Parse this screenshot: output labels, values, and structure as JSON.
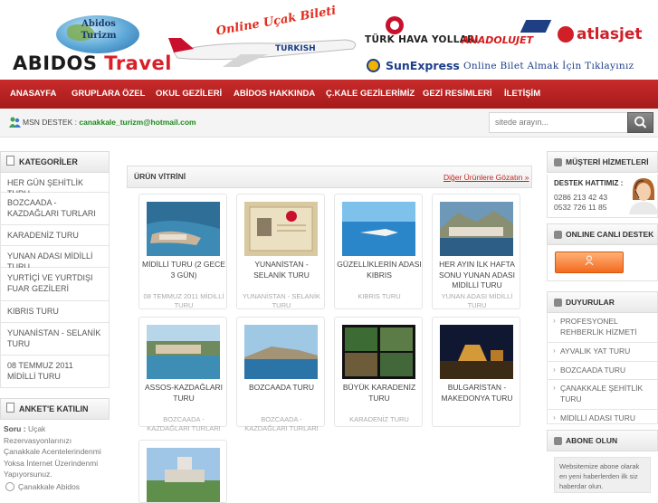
{
  "header": {
    "logo_badge_line1": "Abidos",
    "logo_badge_line2": "Turizm",
    "brand_main": "ABIDOS",
    "brand_accent": "Travel",
    "online_ticket_tag": "Online Uçak Bileti",
    "airlines": {
      "thy": "TÜRK HAVA YOLLARI",
      "anadolujet": "ANADOLUJET",
      "atlasjet": "atlasjet",
      "sunexpress": "SunExpress"
    },
    "online_bilet_text": "Online Bilet Almak İçin Tıklayınız"
  },
  "nav": {
    "items": [
      "ANASAYFA",
      "GRUPLARA ÖZEL",
      "OKUL GEZİLERİ",
      "ABİDOS HAKKINDA",
      "Ç.KALE GEZİLERİMİZ",
      "GEZİ RESİMLERİ",
      "İLETİŞİM"
    ]
  },
  "strip": {
    "msn_label": "MSN DESTEK :",
    "msn_email": "canakkale_turizm@hotmail.com",
    "search_placeholder": "sitede arayın..."
  },
  "left": {
    "categories_title": "KATEGORİLER",
    "categories": [
      "HER GÜN ŞEHİTLİK TURU",
      "BOZCAADA - KAZDAĞLARI TURLARI",
      "KARADENİZ TURU",
      "YUNAN ADASI MİDİLLİ TURU",
      "YURTİÇİ VE YURTDIŞI FUAR GEZİLERİ",
      "KIBRIS TURU",
      "YUNANİSTAN - SELANİK TURU",
      "08 TEMMUZ 2011 MİDİLLİ TURU"
    ],
    "anket_title": "ANKET'E KATILIN",
    "anket_q_label": "Soru :",
    "anket_question": "Uçak Rezervasyonlarınızı Çanakkale Acentelerindenmi Yoksa İnternet Üzerindenmi Yapıyorsunuz.",
    "anket_option1": "Çanakkale Abidos"
  },
  "center": {
    "title": "ÜRÜN VİTRİNİ",
    "more_link": "Diğer Ürünlere Gözatın »",
    "products": [
      {
        "title": "MİDİLLİ TURU (2 GECE 3 GÜN)",
        "category": "08 TEMMUZ 2011 MİDİLLİ TURU"
      },
      {
        "title": "YUNANİSTAN - SELANİK TURU",
        "category": "YUNANİSTAN - SELANİK TURU"
      },
      {
        "title": "GÜZELLİKLERİN ADASI KIBRIS",
        "category": "KIBRIS TURU"
      },
      {
        "title": "HER AYIN İLK HAFTA SONU YUNAN ADASI MİDİLLİ TURU",
        "category": "YUNAN ADASI MİDİLLİ TURU"
      },
      {
        "title": "ASSOS-KAZDAĞLARI TURU",
        "category": "BOZCAADA - KAZDAĞLARI TURLARI"
      },
      {
        "title": "BOZCAADA TURU",
        "category": "BOZCAADA - KAZDAĞLARI TURLARI"
      },
      {
        "title": "BÜYÜK KARADENİZ TURU",
        "category": "KARADENİZ TURU"
      },
      {
        "title": "BULGARİSTAN - MAKEDONYA TURU",
        "category": ""
      }
    ]
  },
  "right": {
    "customer_title": "MÜŞTERİ HİZMETLERİ",
    "hotline_label": "DESTEK HATTIMIZ :",
    "phone1": "0286 213 42 43",
    "phone2": "0532 726 11 85",
    "live_title": "ONLINE CANLI DESTEK",
    "live_button_icon": "user-icon",
    "announcements_title": "DUYURULAR",
    "announcements": [
      "PROFESYONEL REHBERLİK HİZMETİ",
      "AYVALIK YAT TURU",
      "BOZCAADA TURU",
      "ÇANAKKALE ŞEHİTLİK TURU",
      "MİDİLLİ ADASI TURU"
    ],
    "subscribe_title": "ABONE OLUN",
    "subscribe_text": "Websitemize abone olarak en yeni haberlerden ilk siz haberdar olun."
  },
  "colors": {
    "nav_red": "#b52222",
    "accent_red": "#c0261f",
    "msn_green": "#1b8a1b",
    "live_orange": "#f36a1e"
  }
}
